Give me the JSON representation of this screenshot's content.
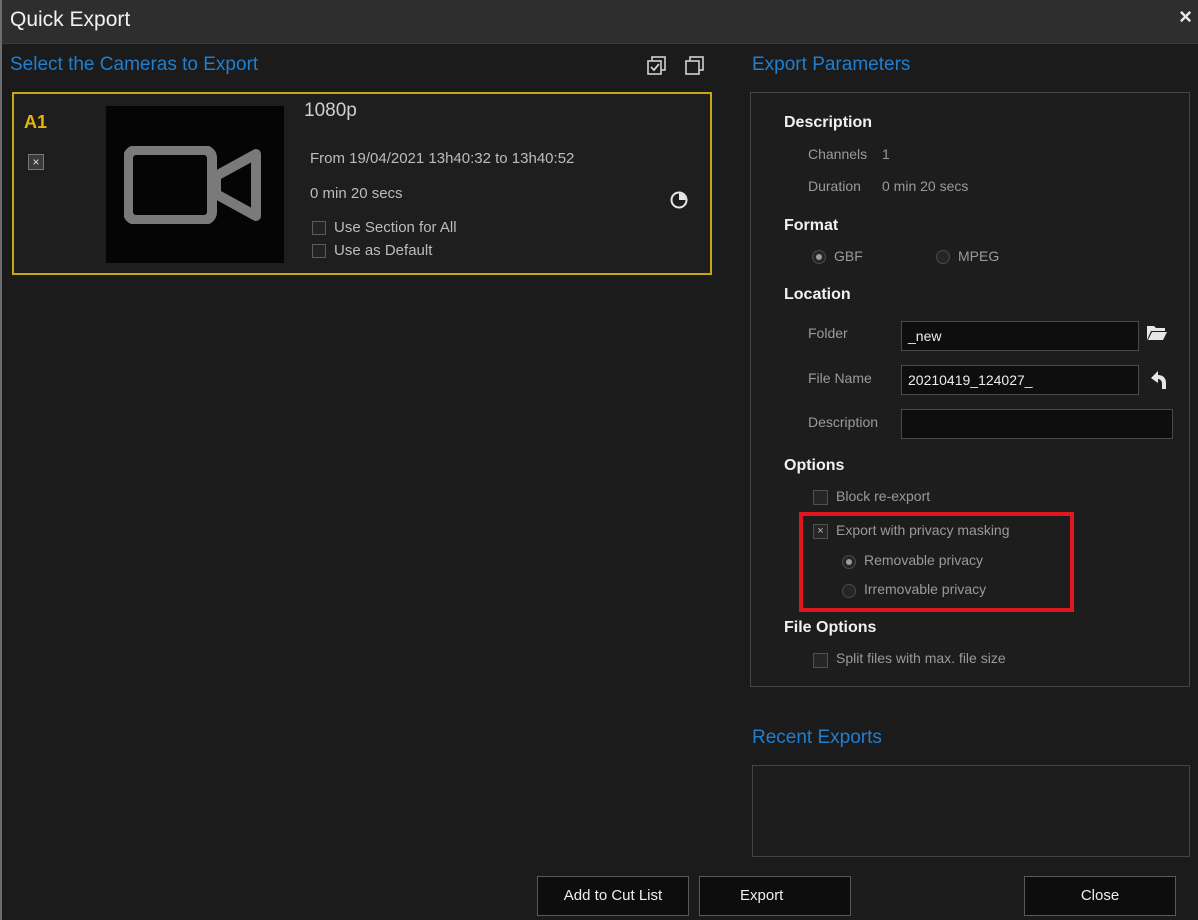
{
  "window": {
    "title": "Quick Export",
    "close_symbol": "×"
  },
  "left": {
    "section_title": "Select the Cameras to Export",
    "icons": [
      "check-all-icon",
      "uncheck-all-icon"
    ],
    "camera": {
      "id": "A1",
      "checked_symbol": "×",
      "resolution": "1080p",
      "range": "From 19/04/2021 13h40:32 to 13h40:52",
      "duration": "0 min 20 secs",
      "use_section_label": "Use Section for All",
      "use_default_label": "Use as Default",
      "thumbnail_icon": "video-camera-icon",
      "time_icon": "clock-icon"
    }
  },
  "right": {
    "section_title": "Export Parameters",
    "description": {
      "heading": "Description",
      "channels_label": "Channels",
      "channels_value": "1",
      "duration_label": "Duration",
      "duration_value": "0 min 20 secs"
    },
    "format": {
      "heading": "Format",
      "options": [
        "GBF",
        "MPEG"
      ],
      "selected": "GBF"
    },
    "location": {
      "heading": "Location",
      "folder_label": "Folder",
      "folder_value": "_new",
      "folder_icon": "folder-open-icon",
      "filename_label": "File Name",
      "filename_value": "20210419_124027_",
      "reset_icon": "undo-icon",
      "description_label": "Description",
      "description_value": ""
    },
    "options": {
      "heading": "Options",
      "block_reexport": "Block re-export",
      "privacy_masking": "Export with privacy masking",
      "privacy_checked_symbol": "×",
      "removable": "Removable privacy",
      "irremovable": "Irremovable privacy",
      "selected_privacy": "Removable privacy"
    },
    "file_options": {
      "heading": "File Options",
      "split": "Split files with max. file size"
    },
    "recent_title": "Recent Exports"
  },
  "buttons": {
    "add_cut": "Add to Cut List",
    "export": "Export",
    "close": "Close"
  },
  "colors": {
    "accent_blue": "#1f7fd0",
    "camera_yellow": "#e6b40a",
    "highlight_red": "#e0171f"
  }
}
